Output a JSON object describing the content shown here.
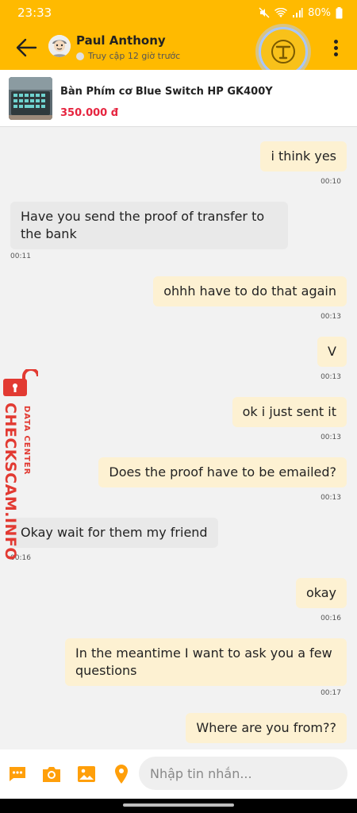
{
  "status_bar": {
    "time": "23:33",
    "battery": "80%"
  },
  "header": {
    "contact_name": "Paul Anthony",
    "presence": "Truy cập 12 giờ trước"
  },
  "product": {
    "title": "Bàn Phím cơ Blue Switch HP GK400Y",
    "price": "350.000 đ"
  },
  "messages": [
    {
      "direction": "out",
      "text": "i think yes",
      "time": "00:10"
    },
    {
      "direction": "in",
      "text": "Have you send the proof of transfer to the bank",
      "time": "00:11"
    },
    {
      "direction": "out",
      "text": "ohhh have to do that again",
      "time": "00:13"
    },
    {
      "direction": "out",
      "text": "V",
      "time": "00:13"
    },
    {
      "direction": "out",
      "text": "ok i just sent it",
      "time": "00:13"
    },
    {
      "direction": "out",
      "text": "Does the proof have to be emailed?",
      "time": "00:13"
    },
    {
      "direction": "in",
      "text": "Okay wait for them my friend",
      "time": "00:16"
    },
    {
      "direction": "out",
      "text": "okay",
      "time": "00:16"
    },
    {
      "direction": "out",
      "text": "In the meantime I want to ask you a few questions",
      "time": "00:17"
    },
    {
      "direction": "out",
      "text": "Where are you from??",
      "time": ""
    }
  ],
  "watermark": {
    "brand": "CHECKSCAM.INFO",
    "subtitle": "DATA CENTER"
  },
  "input_bar": {
    "placeholder": "Nhập tin nhắn..."
  },
  "colors": {
    "header": "#ffba00",
    "accent": "#ff9f0a",
    "outgoing_bubble": "#fdf1d2",
    "incoming_bubble": "#e9e9e9",
    "price": "#e6243f",
    "watermark": "#e23a32"
  }
}
